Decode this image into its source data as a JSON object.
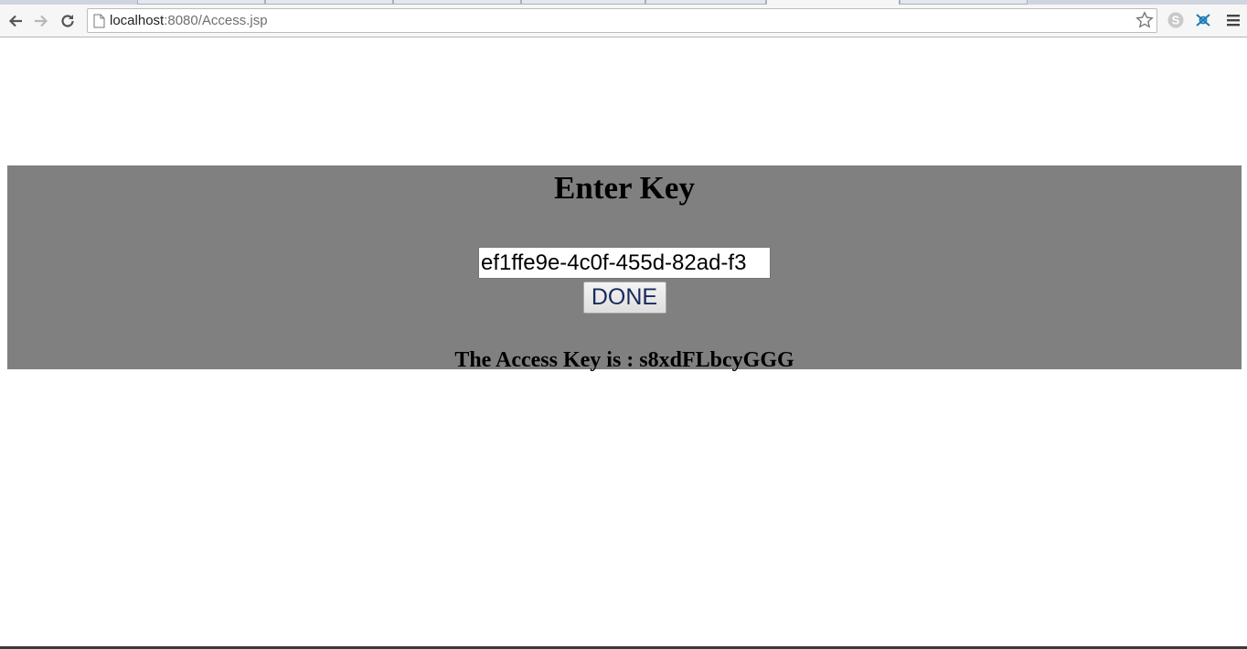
{
  "browser": {
    "url_host": "localhost",
    "url_path": ":8080/Access.jsp"
  },
  "page": {
    "heading": "Enter Key",
    "key_input_value": "ef1ffe9e-4c0f-455d-82ad-f3",
    "done_label": "DONE",
    "access_key_text": "The Access Key is : s8xdFLbcyGGG",
    "panel_color": "#808080"
  },
  "icons": [
    "back-icon",
    "forward-icon",
    "reload-icon",
    "page-icon",
    "star-icon",
    "skype-icon",
    "extension-icon",
    "menu-icon"
  ]
}
